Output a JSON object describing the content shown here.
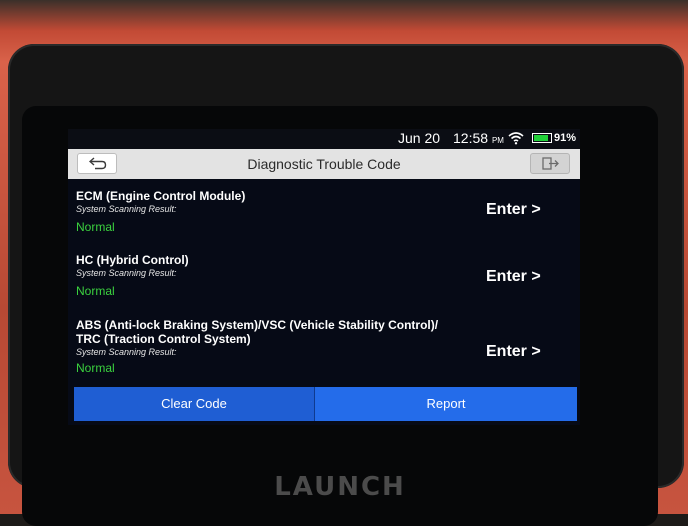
{
  "status_bar": {
    "date": "Jun 20",
    "time": "12:58",
    "ampm": "PM",
    "battery": "91%"
  },
  "header": {
    "title": "Diagnostic Trouble Code"
  },
  "modules": [
    {
      "name": "ECM (Engine Control Module)",
      "subtitle": "System Scanning Result:",
      "status": "Normal",
      "action": "Enter >"
    },
    {
      "name": "HC (Hybrid Control)",
      "subtitle": "System Scanning Result:",
      "status": "Normal",
      "action": "Enter >"
    },
    {
      "name_line1": "ABS (Anti-lock Braking System)/VSC (Vehicle Stability Control)/",
      "name_line2": "TRC (Traction Control System)",
      "subtitle": "System Scanning Result:",
      "status": "Normal",
      "action": "Enter >"
    }
  ],
  "footer": {
    "clear_label": "Clear Code",
    "report_label": "Report"
  },
  "device": {
    "brand": "LAUNCH"
  },
  "colors": {
    "status_normal": "#3bd23f",
    "action_blue": "#246cea",
    "battery_green": "#22d13a"
  }
}
